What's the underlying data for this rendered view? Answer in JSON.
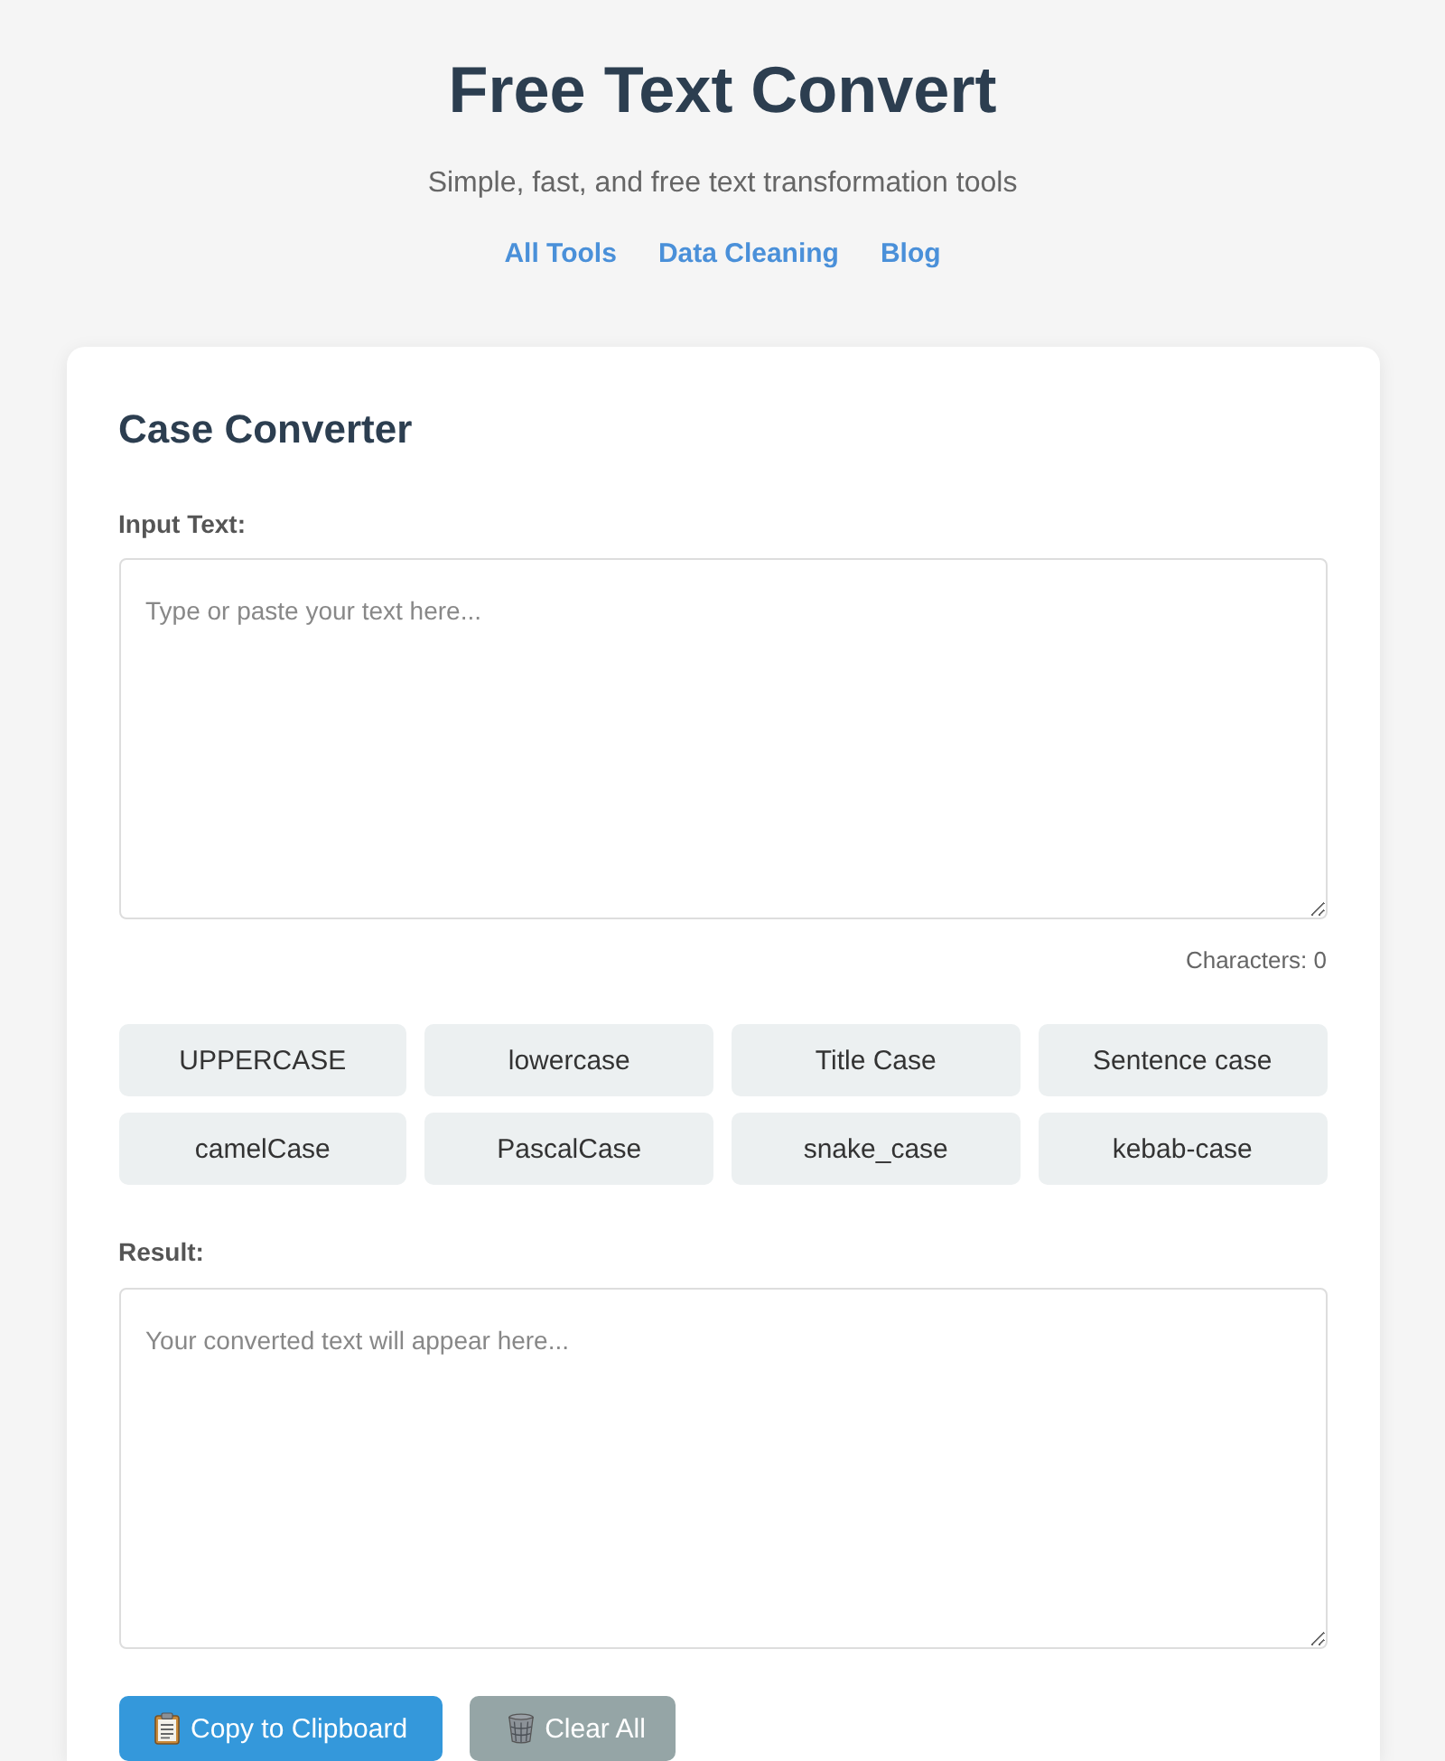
{
  "header": {
    "title": "Free Text Convert",
    "subtitle": "Simple, fast, and free text transformation tools",
    "nav_links": [
      "All Tools",
      "Data Cleaning",
      "Blog"
    ]
  },
  "card": {
    "title": "Case Converter",
    "input": {
      "label": "Input Text:",
      "placeholder": "Type or paste your text here..."
    },
    "character_count": "Characters: 0",
    "case_buttons": [
      "UPPERCASE",
      "lowercase",
      "Title Case",
      "Sentence case",
      "camelCase",
      "PascalCase",
      "snake_case",
      "kebab-case"
    ],
    "result": {
      "label": "Result:",
      "placeholder": "Your converted text will appear here..."
    },
    "actions": [
      {
        "kind": "copy",
        "label": "Copy to Clipboard"
      },
      {
        "kind": "clear",
        "label": "Clear All"
      }
    ]
  }
}
